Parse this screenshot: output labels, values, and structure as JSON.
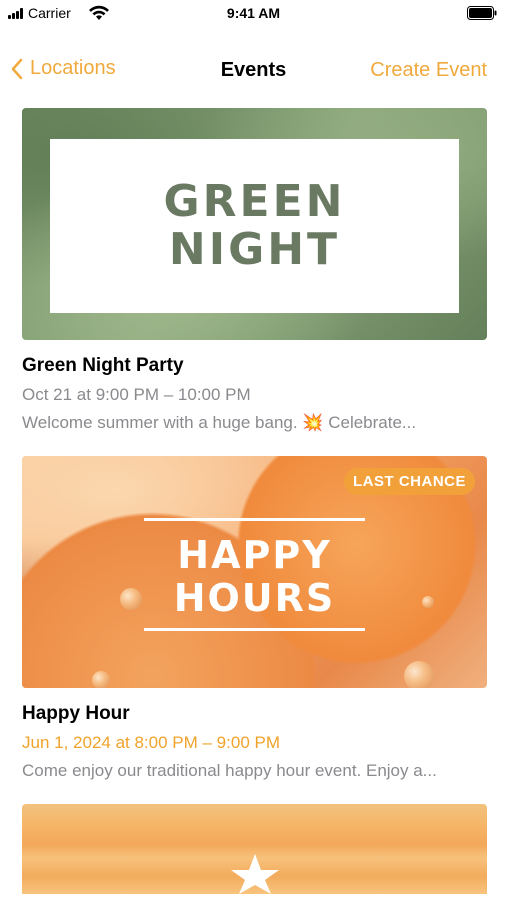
{
  "status_bar": {
    "carrier": "Carrier",
    "time": "9:41 AM",
    "icons": [
      "signal-icon",
      "wifi-icon",
      "battery-icon"
    ]
  },
  "nav": {
    "back_label": "Locations",
    "title": "Events",
    "action_label": "Create Event",
    "accent_color": "#f0a93c"
  },
  "events": [
    {
      "title": "Green Night Party",
      "date": "Oct 21 at 9:00 PM – 10:00 PM",
      "description": "Welcome summer with a huge bang. 💥  Celebrate...",
      "image_text": [
        "GREEN",
        "NIGHT"
      ],
      "badge": ""
    },
    {
      "title": "Happy Hour",
      "date": "Jun 1, 2024 at 8:00 PM – 9:00 PM",
      "description": "Come enjoy our traditional happy hour event. Enjoy a...",
      "image_text": [
        "HAPPY",
        "HOURS"
      ],
      "badge": "LAST CHANCE",
      "date_color": "#f0a32b"
    }
  ]
}
